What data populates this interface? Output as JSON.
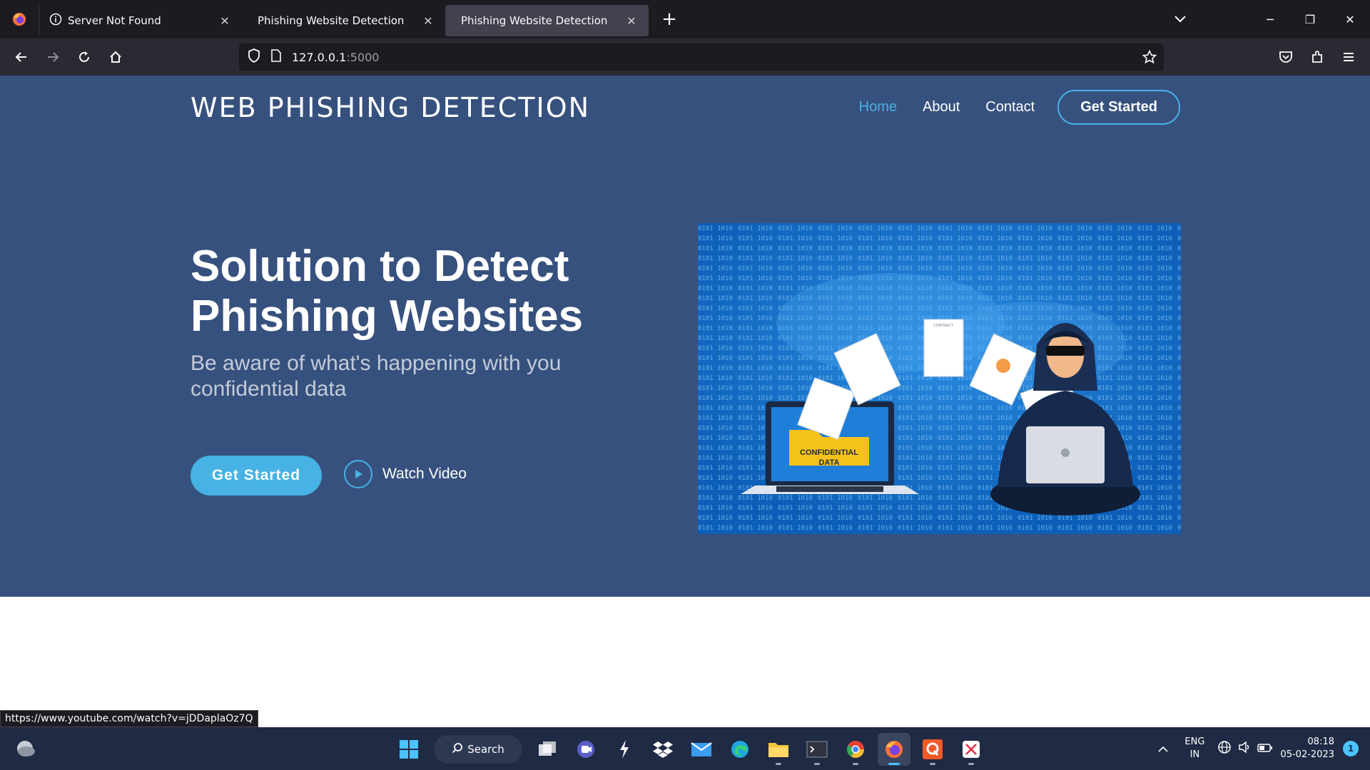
{
  "browser": {
    "tabs": [
      {
        "title": "Server Not Found",
        "icon": "info-icon"
      },
      {
        "title": "Phishing Website Detection",
        "icon": "none"
      },
      {
        "title": "Phishing Website Detection",
        "icon": "none"
      }
    ],
    "active_tab": 2,
    "url_host": "127.0.0.1",
    "url_port": ":5000"
  },
  "site": {
    "brand": "WEB PHISHING DETECTION",
    "nav": {
      "home": "Home",
      "about": "About",
      "contact": "Contact",
      "cta": "Get Started"
    },
    "hero": {
      "title": "Solution to Detect Phishing Websites",
      "subtitle": "Be aware of what's happening with you confidential data",
      "primary_button": "Get Started",
      "video_link": "Watch Video",
      "image_label": "CONFIDENTIAL DATA",
      "image_doc_label": "CONTRACT"
    },
    "colors": {
      "hero_bg": "#37517e",
      "accent": "#47b2e4"
    }
  },
  "status_link": "https://www.youtube.com/watch?v=jDDaplaOz7Q",
  "taskbar": {
    "search_label": "Search",
    "lang_line1": "ENG",
    "lang_line2": "IN",
    "time": "08:18",
    "date": "05-02-2023",
    "notifications": "1"
  }
}
